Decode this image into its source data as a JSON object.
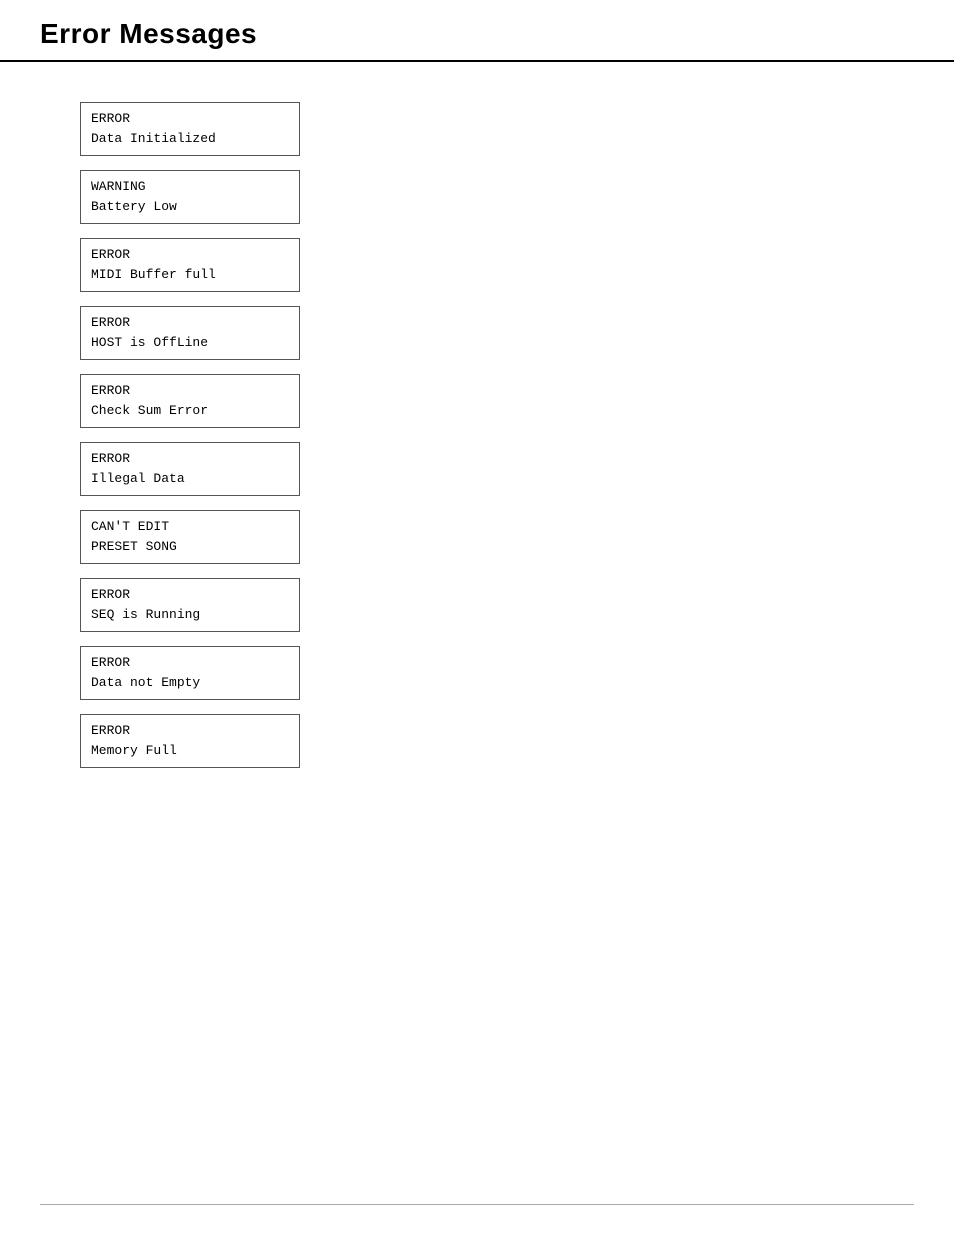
{
  "page": {
    "title": "Error Messages"
  },
  "errors": [
    {
      "line1": "ERROR",
      "line2": "Data Initialized"
    },
    {
      "line1": "WARNING",
      "line2": "Battery Low"
    },
    {
      "line1": "ERROR",
      "line2": "MIDI Buffer full"
    },
    {
      "line1": "ERROR",
      "line2": "HOST is OffLine"
    },
    {
      "line1": "ERROR",
      "line2": "Check Sum Error"
    },
    {
      "line1": "ERROR",
      "line2": "Illegal Data"
    },
    {
      "line1": "CAN'T EDIT",
      "line2": "PRESET SONG"
    },
    {
      "line1": "ERROR",
      "line2": "SEQ is Running"
    },
    {
      "line1": "ERROR",
      "line2": "Data not Empty"
    },
    {
      "line1": "ERROR",
      "line2": "Memory Full"
    }
  ]
}
